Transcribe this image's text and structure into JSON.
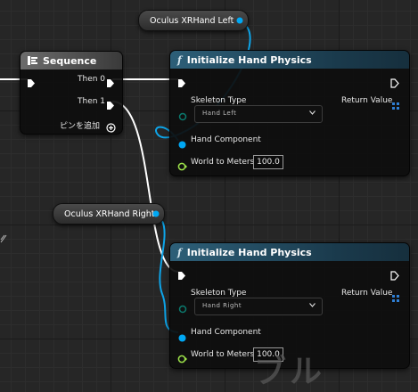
{
  "sequence": {
    "title": "Sequence",
    "then0": "Then 0",
    "then1": "Then 1",
    "add_pin": "ピンを追加"
  },
  "getters": {
    "left": "Oculus XRHand Left",
    "right": "Oculus XRHand Right"
  },
  "init_left": {
    "title": "Initialize Hand Physics",
    "skeleton_type_label": "Skeleton Type",
    "skeleton_type_value": "Hand Left",
    "return_value_label": "Return Value",
    "hand_component_label": "Hand Component",
    "world_to_meters_label": "World to Meters",
    "world_to_meters_value": "100.0"
  },
  "init_right": {
    "title": "Initialize Hand Physics",
    "skeleton_type_label": "Skeleton Type",
    "skeleton_type_value": "Hand Right",
    "return_value_label": "Return Value",
    "hand_component_label": "Hand Component",
    "world_to_meters_label": "World to Meters",
    "world_to_meters_value": "100.0"
  },
  "watermark": "ブル",
  "colors": {
    "exec": "#ffffff",
    "object_pin": "#00a8f4",
    "float_pin": "#9de34a",
    "enum_pin": "#0b5a52",
    "struct_pin": "#2f7fd4"
  }
}
